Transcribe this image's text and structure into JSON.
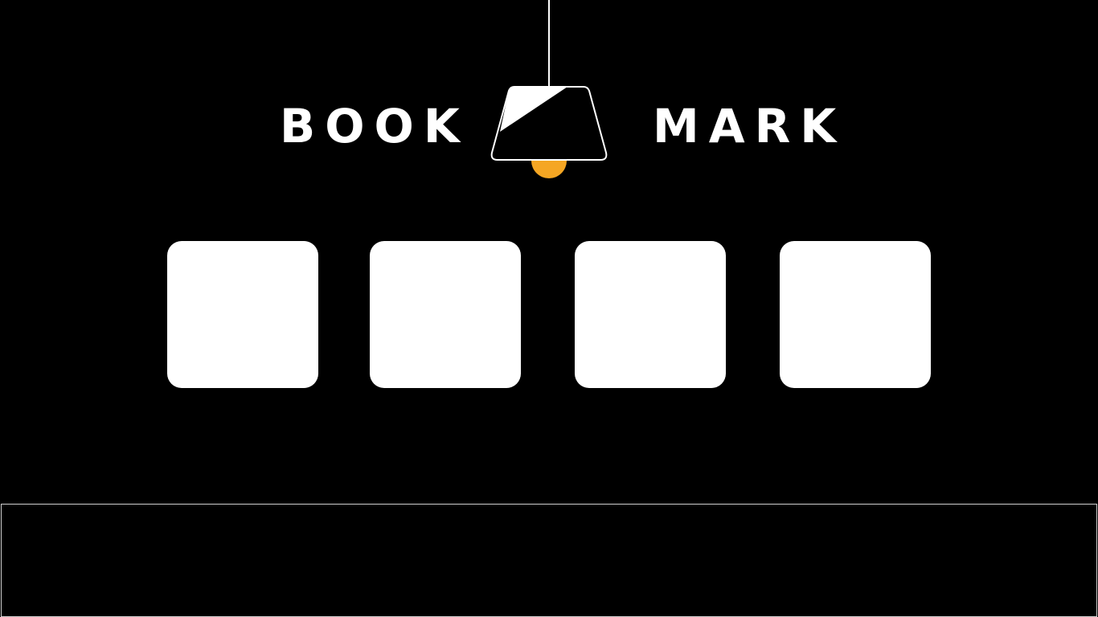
{
  "logo": {
    "word_left": "BOOK",
    "word_right": "MARK"
  },
  "lamp": {
    "icon": "pendant-lamp-icon",
    "bulb_color": "#F5A623",
    "shade_color": "#000000",
    "outline_color": "#FFFFFF"
  },
  "bookmarks": [
    {
      "icon": "bookmark-tile"
    },
    {
      "icon": "bookmark-tile"
    },
    {
      "icon": "bookmark-tile"
    },
    {
      "icon": "bookmark-tile"
    }
  ],
  "colors": {
    "background": "#000000",
    "tile": "#FFFFFF",
    "accent": "#F5A623",
    "panel_border": "#CFCFCF"
  }
}
